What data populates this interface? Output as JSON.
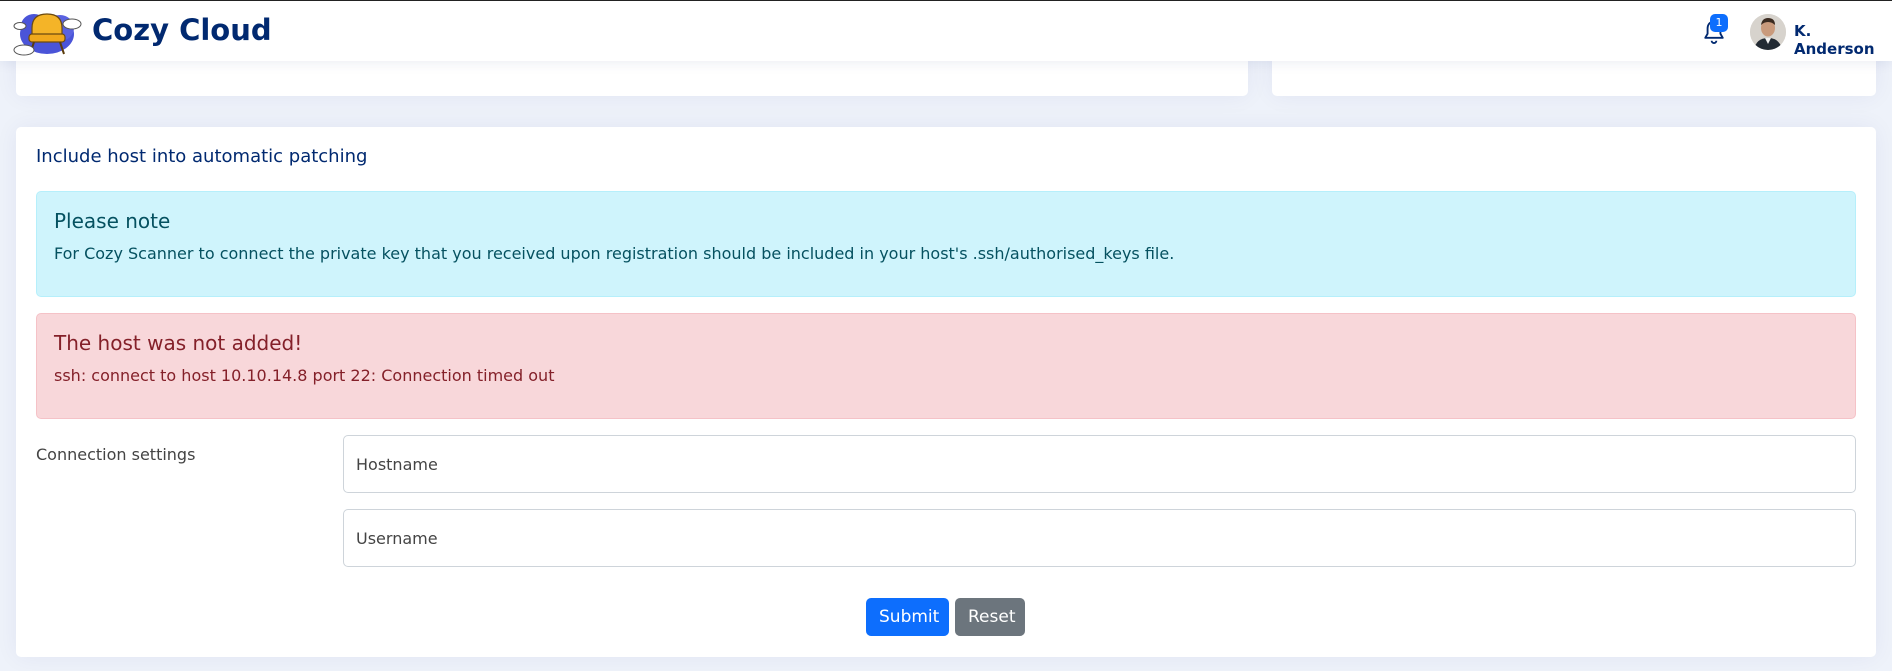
{
  "header": {
    "brand": "Cozy Cloud",
    "notifications_count": "1",
    "user_name": "K. Anderson"
  },
  "main": {
    "title": "Include host into automatic patching",
    "info_alert": {
      "heading": "Please note",
      "body": "For Cozy Scanner to connect the private key that you received upon registration should be included in your host's .ssh/authorised_keys file."
    },
    "error_alert": {
      "heading": "The host was not added!",
      "body": "ssh: connect to host 10.10.14.8 port 22: Connection timed out"
    },
    "form": {
      "section_label": "Connection settings",
      "hostname_placeholder": "Hostname",
      "username_placeholder": "Username",
      "submit_label": "Submit",
      "reset_label": "Reset"
    }
  },
  "colors": {
    "brand": "#012970",
    "primary": "#0d6efd",
    "secondary": "#6c757d",
    "info_bg": "#cff4fc",
    "danger_bg": "#f8d7da"
  },
  "icons": [
    "cozy-cloud-logo-icon",
    "bell-icon",
    "avatar"
  ]
}
